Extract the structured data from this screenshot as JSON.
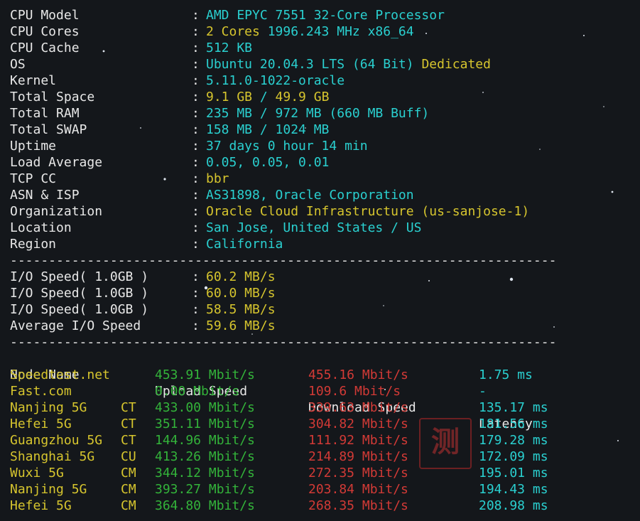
{
  "sysinfo": [
    {
      "key": "CPU Model",
      "value": "AMD EPYC 7551 32-Core Processor",
      "color": "cy"
    },
    {
      "key": "CPU Cores",
      "value": "",
      "parts": [
        {
          "t": "2 Cores",
          "c": "yl"
        },
        {
          "t": " 1996.243 MHz x86_64",
          "c": "cy"
        }
      ]
    },
    {
      "key": "CPU Cache",
      "value": "512 KB",
      "color": "cy"
    },
    {
      "key": "OS",
      "value": "",
      "parts": [
        {
          "t": "Ubuntu 20.04.3 LTS (64 Bit)",
          "c": "cy"
        },
        {
          "t": " Dedicated",
          "c": "yl"
        }
      ]
    },
    {
      "key": "Kernel",
      "value": "5.11.0-1022-oracle",
      "color": "cy"
    },
    {
      "key": "Total Space",
      "value": "",
      "parts": [
        {
          "t": "9.1 GB",
          "c": "yl"
        },
        {
          "t": " / ",
          "c": "cy"
        },
        {
          "t": "49.9 GB",
          "c": "yl"
        }
      ]
    },
    {
      "key": "Total RAM",
      "value": "",
      "parts": [
        {
          "t": "235 MB / 972 MB (660 MB Buff)",
          "c": "cy"
        }
      ]
    },
    {
      "key": "Total SWAP",
      "value": "158 MB / 1024 MB",
      "color": "cy"
    },
    {
      "key": "Uptime",
      "value": "37 days 0 hour 14 min",
      "color": "cy"
    },
    {
      "key": "Load Average",
      "value": "0.05, 0.05, 0.01",
      "color": "cy"
    },
    {
      "key": "TCP CC",
      "value": "bbr",
      "color": "yl"
    },
    {
      "key": "ASN & ISP",
      "value": "AS31898, Oracle Corporation",
      "color": "cy"
    },
    {
      "key": "Organization",
      "value": "Oracle Cloud Infrastructure (us-sanjose-1)",
      "color": "yl"
    },
    {
      "key": "Location",
      "value": "San Jose, United States / US",
      "color": "cy"
    },
    {
      "key": "Region",
      "value": "California",
      "color": "cy"
    }
  ],
  "separator": "-----------------------------------------------------------------------",
  "colon": ":",
  "io": [
    {
      "key": "I/O Speed( 1.0GB )",
      "value": "60.2 MB/s"
    },
    {
      "key": "I/O Speed( 1.0GB )",
      "value": "60.0 MB/s"
    },
    {
      "key": "I/O Speed( 1.0GB )",
      "value": "58.5 MB/s"
    },
    {
      "key": "Average I/O Speed",
      "value": "59.6 MB/s"
    }
  ],
  "speed_header": {
    "node": "Node Name",
    "upload": "Upload Speed",
    "download": "Download Speed",
    "latency": "Latency"
  },
  "speed_rows": [
    {
      "node": "Speedtest.net",
      "isp": "",
      "up": "453.91 Mbit/s",
      "down": "455.16 Mbit/s",
      "lat": "1.75 ms"
    },
    {
      "node": "Fast.com",
      "isp": "",
      "up": "0.00 Mbit/s",
      "down": "109.6 Mbit/s",
      "lat": "-"
    },
    {
      "node": "Nanjing 5G",
      "isp": "CT",
      "up": "433.00 Mbit/s",
      "down": "339.63 Mbit/s",
      "lat": "135.17 ms"
    },
    {
      "node": "Hefei 5G",
      "isp": "CT",
      "up": "351.11 Mbit/s",
      "down": "304.82 Mbit/s",
      "lat": "181.56 ms"
    },
    {
      "node": "Guangzhou 5G",
      "isp": "CT",
      "up": "144.96 Mbit/s",
      "down": "111.92 Mbit/s",
      "lat": "179.28 ms"
    },
    {
      "node": "Shanghai 5G",
      "isp": "CU",
      "up": "413.26 Mbit/s",
      "down": "214.89 Mbit/s",
      "lat": "172.09 ms"
    },
    {
      "node": "Wuxi 5G",
      "isp": "CM",
      "up": "344.12 Mbit/s",
      "down": "272.35 Mbit/s",
      "lat": "195.01 ms"
    },
    {
      "node": "Nanjing 5G",
      "isp": "CM",
      "up": "393.27 Mbit/s",
      "down": "203.84 Mbit/s",
      "lat": "194.43 ms"
    },
    {
      "node": "Hefei 5G",
      "isp": "CM",
      "up": "364.80 Mbit/s",
      "down": "268.35 Mbit/s",
      "lat": "208.98 ms"
    }
  ],
  "watermark": "测"
}
